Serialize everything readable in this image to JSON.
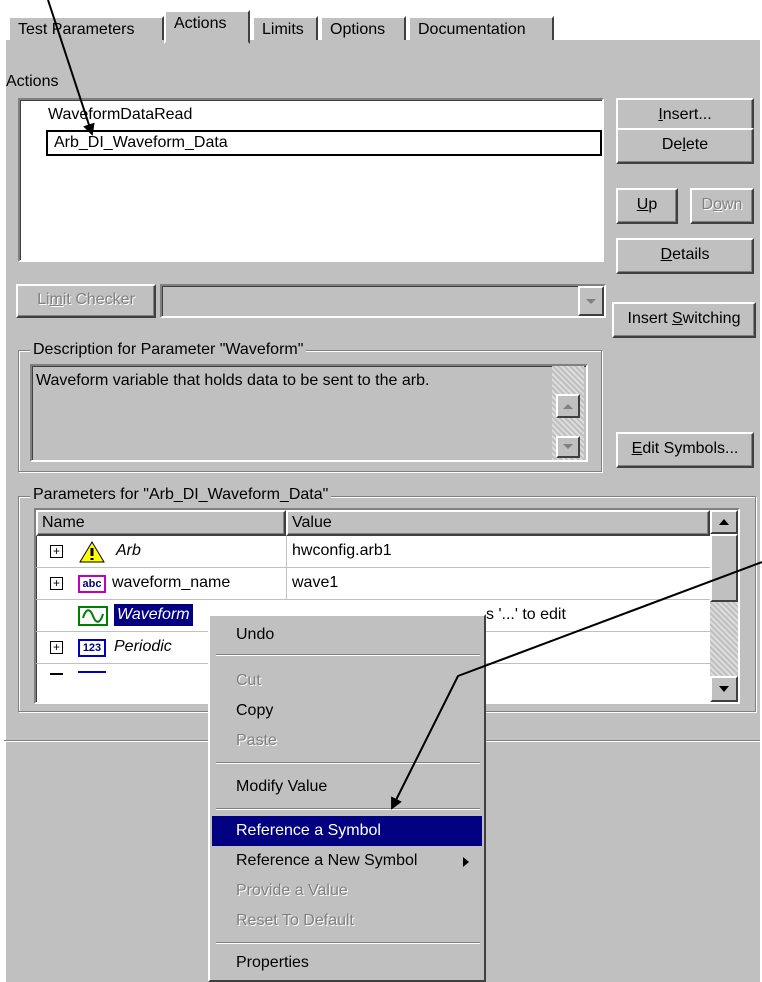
{
  "tabs": [
    "Test Parameters",
    "Actions",
    "Limits",
    "Options",
    "Documentation"
  ],
  "actions": {
    "label": "Actions",
    "items": [
      "WaveformDataRead",
      "Arb_DI_Waveform_Data"
    ]
  },
  "buttons": {
    "insert": "Insert...",
    "delete": "Delete",
    "up": "Up",
    "down": "Down",
    "details": "Details",
    "insert_switching": "Insert Switching",
    "edit_symbols": "Edit Symbols...",
    "limit_checker": "Limit Checker"
  },
  "description": {
    "title": "Description for Parameter \"Waveform\"",
    "text": "Waveform variable that holds data to be sent to the arb."
  },
  "parameters": {
    "title": "Parameters for \"Arb_DI_Waveform_Data\"",
    "columns": [
      "Name",
      "Value"
    ],
    "rows": [
      {
        "name": "Arb",
        "value": "hwconfig.arb1",
        "icon": "warning-icon",
        "type_badge": ""
      },
      {
        "name": "waveform_name",
        "value": "wave1",
        "icon": "string-type-icon",
        "type_badge": "abc"
      },
      {
        "name": "Waveform",
        "value": "s '...' to edit",
        "icon": "waveform-type-icon",
        "type_badge": ""
      },
      {
        "name": "Periodic",
        "value": "",
        "icon": "numeric-type-icon",
        "type_badge": "123"
      }
    ]
  },
  "context_menu": {
    "items": [
      {
        "label": "Undo",
        "enabled": true
      },
      {
        "label": "Cut",
        "enabled": false
      },
      {
        "label": "Copy",
        "enabled": true
      },
      {
        "label": "Paste",
        "enabled": false
      },
      {
        "label": "Modify Value",
        "enabled": true
      },
      {
        "label": "Reference a Symbol",
        "enabled": true,
        "selected": true
      },
      {
        "label": "Reference a New Symbol",
        "enabled": true,
        "submenu": true
      },
      {
        "label": "Provide a Value",
        "enabled": false
      },
      {
        "label": "Reset To Default",
        "enabled": false
      },
      {
        "label": "Properties",
        "enabled": true
      }
    ]
  },
  "colors": {
    "dialog_bg": "#c0c0c0",
    "selection": "#000080",
    "highlight_text": "#ffffff"
  }
}
